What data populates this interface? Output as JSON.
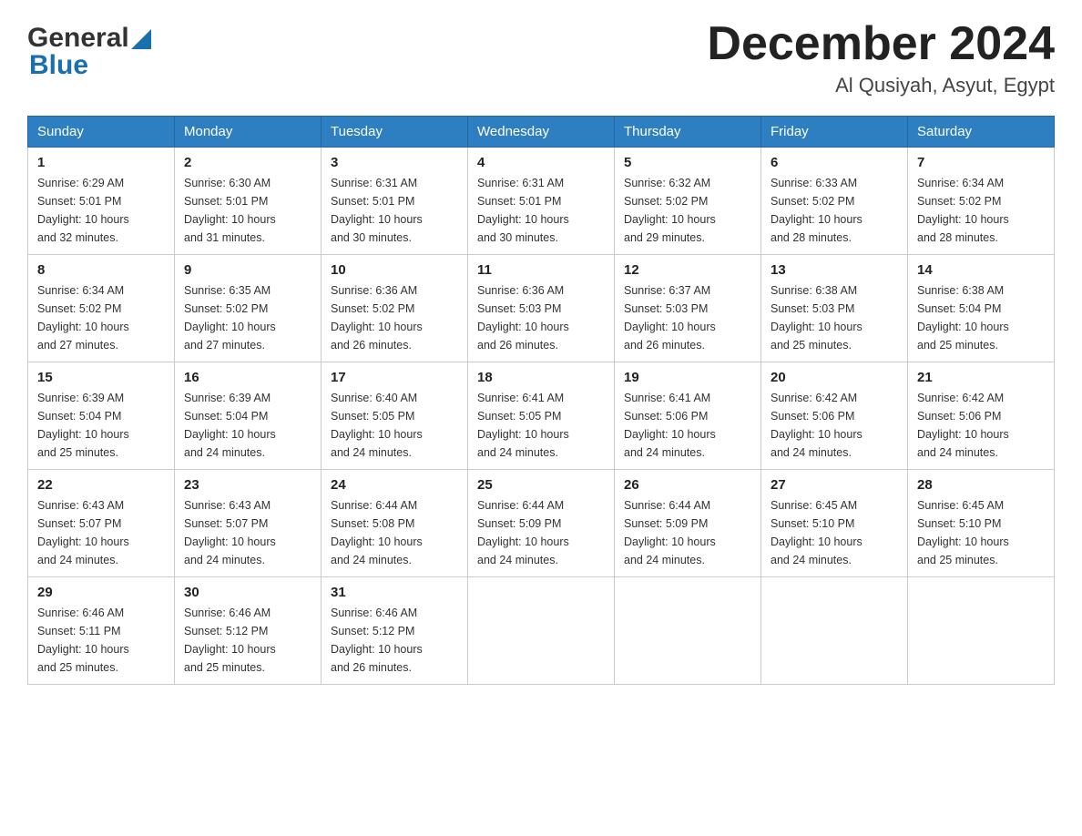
{
  "header": {
    "logo_general": "General",
    "logo_blue": "Blue",
    "month_title": "December 2024",
    "location": "Al Qusiyah, Asyut, Egypt"
  },
  "weekdays": [
    "Sunday",
    "Monday",
    "Tuesday",
    "Wednesday",
    "Thursday",
    "Friday",
    "Saturday"
  ],
  "weeks": [
    [
      {
        "day": "1",
        "info": "Sunrise: 6:29 AM\nSunset: 5:01 PM\nDaylight: 10 hours\nand 32 minutes."
      },
      {
        "day": "2",
        "info": "Sunrise: 6:30 AM\nSunset: 5:01 PM\nDaylight: 10 hours\nand 31 minutes."
      },
      {
        "day": "3",
        "info": "Sunrise: 6:31 AM\nSunset: 5:01 PM\nDaylight: 10 hours\nand 30 minutes."
      },
      {
        "day": "4",
        "info": "Sunrise: 6:31 AM\nSunset: 5:01 PM\nDaylight: 10 hours\nand 30 minutes."
      },
      {
        "day": "5",
        "info": "Sunrise: 6:32 AM\nSunset: 5:02 PM\nDaylight: 10 hours\nand 29 minutes."
      },
      {
        "day": "6",
        "info": "Sunrise: 6:33 AM\nSunset: 5:02 PM\nDaylight: 10 hours\nand 28 minutes."
      },
      {
        "day": "7",
        "info": "Sunrise: 6:34 AM\nSunset: 5:02 PM\nDaylight: 10 hours\nand 28 minutes."
      }
    ],
    [
      {
        "day": "8",
        "info": "Sunrise: 6:34 AM\nSunset: 5:02 PM\nDaylight: 10 hours\nand 27 minutes."
      },
      {
        "day": "9",
        "info": "Sunrise: 6:35 AM\nSunset: 5:02 PM\nDaylight: 10 hours\nand 27 minutes."
      },
      {
        "day": "10",
        "info": "Sunrise: 6:36 AM\nSunset: 5:02 PM\nDaylight: 10 hours\nand 26 minutes."
      },
      {
        "day": "11",
        "info": "Sunrise: 6:36 AM\nSunset: 5:03 PM\nDaylight: 10 hours\nand 26 minutes."
      },
      {
        "day": "12",
        "info": "Sunrise: 6:37 AM\nSunset: 5:03 PM\nDaylight: 10 hours\nand 26 minutes."
      },
      {
        "day": "13",
        "info": "Sunrise: 6:38 AM\nSunset: 5:03 PM\nDaylight: 10 hours\nand 25 minutes."
      },
      {
        "day": "14",
        "info": "Sunrise: 6:38 AM\nSunset: 5:04 PM\nDaylight: 10 hours\nand 25 minutes."
      }
    ],
    [
      {
        "day": "15",
        "info": "Sunrise: 6:39 AM\nSunset: 5:04 PM\nDaylight: 10 hours\nand 25 minutes."
      },
      {
        "day": "16",
        "info": "Sunrise: 6:39 AM\nSunset: 5:04 PM\nDaylight: 10 hours\nand 24 minutes."
      },
      {
        "day": "17",
        "info": "Sunrise: 6:40 AM\nSunset: 5:05 PM\nDaylight: 10 hours\nand 24 minutes."
      },
      {
        "day": "18",
        "info": "Sunrise: 6:41 AM\nSunset: 5:05 PM\nDaylight: 10 hours\nand 24 minutes."
      },
      {
        "day": "19",
        "info": "Sunrise: 6:41 AM\nSunset: 5:06 PM\nDaylight: 10 hours\nand 24 minutes."
      },
      {
        "day": "20",
        "info": "Sunrise: 6:42 AM\nSunset: 5:06 PM\nDaylight: 10 hours\nand 24 minutes."
      },
      {
        "day": "21",
        "info": "Sunrise: 6:42 AM\nSunset: 5:06 PM\nDaylight: 10 hours\nand 24 minutes."
      }
    ],
    [
      {
        "day": "22",
        "info": "Sunrise: 6:43 AM\nSunset: 5:07 PM\nDaylight: 10 hours\nand 24 minutes."
      },
      {
        "day": "23",
        "info": "Sunrise: 6:43 AM\nSunset: 5:07 PM\nDaylight: 10 hours\nand 24 minutes."
      },
      {
        "day": "24",
        "info": "Sunrise: 6:44 AM\nSunset: 5:08 PM\nDaylight: 10 hours\nand 24 minutes."
      },
      {
        "day": "25",
        "info": "Sunrise: 6:44 AM\nSunset: 5:09 PM\nDaylight: 10 hours\nand 24 minutes."
      },
      {
        "day": "26",
        "info": "Sunrise: 6:44 AM\nSunset: 5:09 PM\nDaylight: 10 hours\nand 24 minutes."
      },
      {
        "day": "27",
        "info": "Sunrise: 6:45 AM\nSunset: 5:10 PM\nDaylight: 10 hours\nand 24 minutes."
      },
      {
        "day": "28",
        "info": "Sunrise: 6:45 AM\nSunset: 5:10 PM\nDaylight: 10 hours\nand 25 minutes."
      }
    ],
    [
      {
        "day": "29",
        "info": "Sunrise: 6:46 AM\nSunset: 5:11 PM\nDaylight: 10 hours\nand 25 minutes."
      },
      {
        "day": "30",
        "info": "Sunrise: 6:46 AM\nSunset: 5:12 PM\nDaylight: 10 hours\nand 25 minutes."
      },
      {
        "day": "31",
        "info": "Sunrise: 6:46 AM\nSunset: 5:12 PM\nDaylight: 10 hours\nand 26 minutes."
      },
      {
        "day": "",
        "info": ""
      },
      {
        "day": "",
        "info": ""
      },
      {
        "day": "",
        "info": ""
      },
      {
        "day": "",
        "info": ""
      }
    ]
  ]
}
